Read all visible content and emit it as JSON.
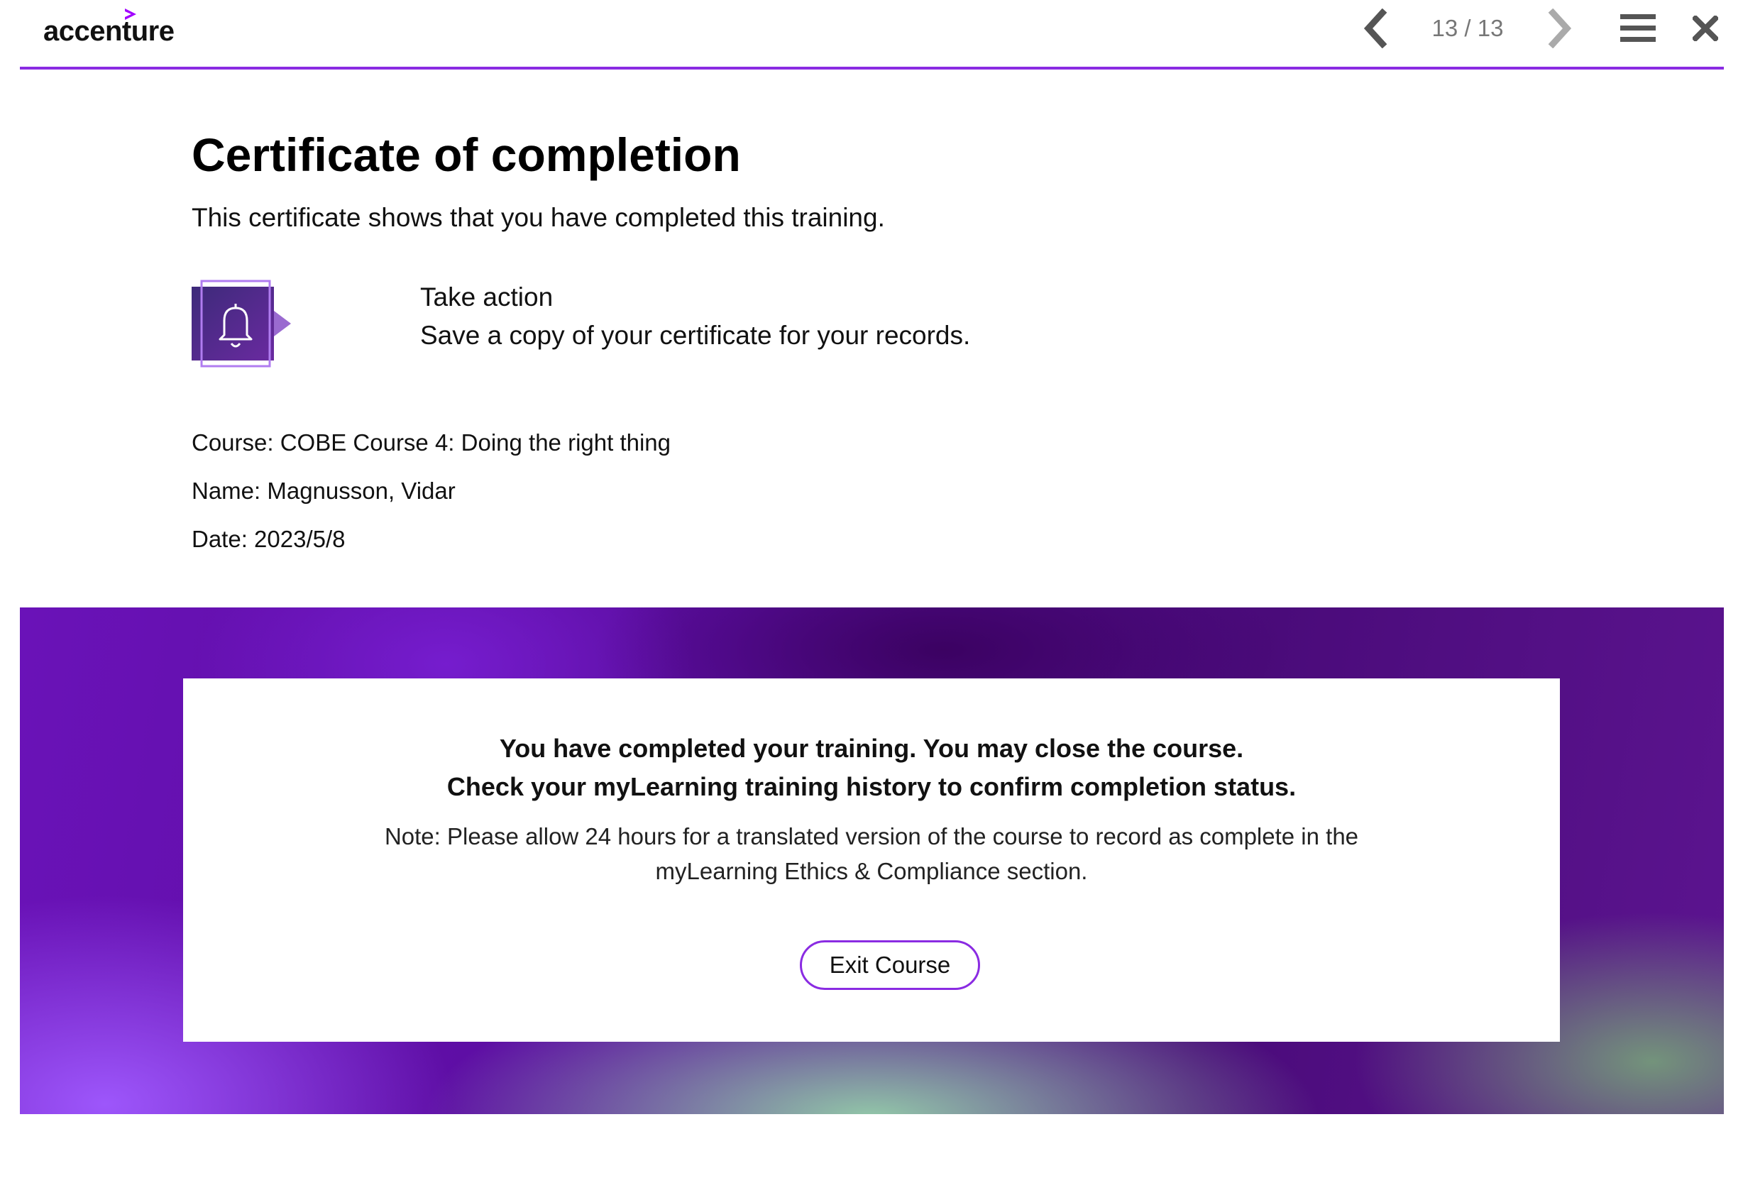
{
  "header": {
    "logo_text": "accenture",
    "page_counter": "13 / 13",
    "icons": {
      "prev": "chevron-left-icon",
      "next": "chevron-right-icon",
      "menu": "hamburger-menu-icon",
      "close": "close-icon"
    }
  },
  "main": {
    "title": "Certificate of completion",
    "subtitle": "This certificate shows that you have completed this training.",
    "action": {
      "icon": "bell-icon",
      "title": "Take action",
      "description": "Save a copy of your certificate for your records."
    },
    "course_line": "Course: COBE Course 4: Doing the right thing",
    "name_line": "Name: Magnusson, Vidar",
    "date_line": "Date: 2023/5/8"
  },
  "banner": {
    "line1": "You have completed your training. You may close the course.",
    "line2": "Check your myLearning training history to confirm completion status.",
    "note": "Note: Please allow 24 hours for a translated version of the course to record as complete in the myLearning Ethics & Compliance section.",
    "exit_button": "Exit Course"
  },
  "colors": {
    "accent": "#8a2be2",
    "nav_active": "#555555",
    "nav_disabled": "#aaaaaa"
  }
}
